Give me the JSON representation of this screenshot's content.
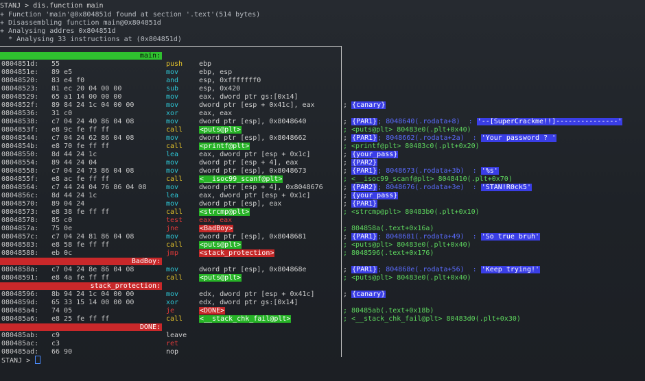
{
  "header": {
    "line0": "STANJ > dis.function main",
    "line1": "+ Function 'main'@0x804851d found at section '.text'(514 bytes)",
    "line2": "+ Disassembling function main@0x804851d",
    "line3": "+ Analysing addres 0x804851d",
    "line4": "  * Analysing 33 instructions at (0x804851d)"
  },
  "labels": {
    "main": "main:",
    "badboy": "BadBoy:",
    "stack_protection": "stack_protection:",
    "done": "DONE:"
  },
  "rows": [
    {
      "addr": "0804851d:",
      "bytes": "55",
      "mn": "push",
      "ops": "ebp",
      "cm": ""
    },
    {
      "addr": "0804851e:",
      "bytes": "89 e5",
      "mn": "mov",
      "ops": "ebp, esp",
      "cm": ""
    },
    {
      "addr": "08048520:",
      "bytes": "83 e4 f0",
      "mn": "and",
      "ops": "esp, 0xfffffff0",
      "cm": ""
    },
    {
      "addr": "08048523:",
      "bytes": "81 ec 20 04 00 00",
      "mn": "sub",
      "ops": "esp, 0x420",
      "cm": ""
    },
    {
      "addr": "08048529:",
      "bytes": "65 a1 14 00 00 00",
      "mn": "mov",
      "ops": "eax, dword ptr gs:[0x14]",
      "cm": ""
    },
    {
      "addr": "0804852f:",
      "bytes": "89 84 24 1c 04 00 00",
      "mn": "mov",
      "ops": "dword ptr [esp + 0x41c], eax",
      "cm_semi": ";",
      "cm_hl": "{canary}"
    },
    {
      "addr": "08048536:",
      "bytes": "31 c0",
      "mn": "xor",
      "ops": "eax, eax",
      "cm": ""
    },
    {
      "addr": "08048538:",
      "bytes": "c7 04 24 40 86 04 08",
      "mn": "mov",
      "ops": "dword ptr [esp], 0x8048640",
      "cm_semi": ";",
      "cm_hl": "{PAR1}",
      "cm_rest": "; 8048640(.rodata+8)  :",
      "cm_str": "'--[SuperCrackme!!]---------------'"
    },
    {
      "addr": "0804853f:",
      "bytes": "e8 9c fe ff ff",
      "mn": "call",
      "ops_hl": "<puts@plt>",
      "cm_plain": "; <puts@plt> 80483e0(.plt+0x40)"
    },
    {
      "addr": "08048544:",
      "bytes": "c7 04 24 62 86 04 08",
      "mn": "mov",
      "ops": "dword ptr [esp], 0x8048662",
      "cm_semi": ";",
      "cm_hl": "{PAR1}",
      "cm_rest": "; 8048662(.rodata+2a)  :",
      "cm_str": "'Your password ? '"
    },
    {
      "addr": "0804854b:",
      "bytes": "e8 70 fe ff ff",
      "mn": "call",
      "ops_hl": "<printf@plt>",
      "cm_plain": "; <printf@plt> 80483c0(.plt+0x20)"
    },
    {
      "addr": "08048550:",
      "bytes": "8d 44 24 1c",
      "mn": "lea",
      "ops": "eax, dword ptr [esp + 0x1c]",
      "cm_semi": ";",
      "cm_hl": "{your_pass}"
    },
    {
      "addr": "08048554:",
      "bytes": "89 44 24 04",
      "mn": "mov",
      "ops": "dword ptr [esp + 4], eax",
      "cm_semi": ";",
      "cm_hl": "{PAR2}"
    },
    {
      "addr": "08048558:",
      "bytes": "c7 04 24 73 86 04 08",
      "mn": "mov",
      "ops": "dword ptr [esp], 0x8048673",
      "cm_semi": ";",
      "cm_hl": "{PAR1}",
      "cm_rest": "; 8048673(.rodata+3b)  :",
      "cm_str": "'%s'"
    },
    {
      "addr": "0804855f:",
      "bytes": "e8 ac fe ff ff",
      "mn": "call",
      "ops_hl": "<__isoc99_scanf@plt>",
      "cm_plain": "; <__isoc99_scanf@plt> 8048410(.plt+0x70)"
    },
    {
      "addr": "08048564:",
      "bytes": "c7 44 24 04 76 86 04 08",
      "mn": "mov",
      "ops": "dword ptr [esp + 4], 0x8048676",
      "cm_semi": ";",
      "cm_hl": "{PAR2}",
      "cm_rest": "; 8048676(.rodata+3e)  :",
      "cm_str": "'STAN!R0ck5'"
    },
    {
      "addr": "0804856c:",
      "bytes": "8d 44 24 1c",
      "mn": "lea",
      "ops": "eax, dword ptr [esp + 0x1c]",
      "cm_semi": ";",
      "cm_hl": "{your_pass}"
    },
    {
      "addr": "08048570:",
      "bytes": "89 04 24",
      "mn": "mov",
      "ops": "dword ptr [esp], eax",
      "cm_semi": ";",
      "cm_hl": "{PAR1}"
    },
    {
      "addr": "08048573:",
      "bytes": "e8 38 fe ff ff",
      "mn": "call",
      "ops_hl": "<strcmp@plt>",
      "cm_plain": "; <strcmp@plt> 80483b0(.plt+0x10)"
    },
    {
      "addr": "08048578:",
      "bytes": "85 c0",
      "mn": "test",
      "ops_red": "eax, eax",
      "cm": ""
    },
    {
      "addr": "0804857a:",
      "bytes": "75 0e",
      "mn": "jne",
      "ops_rhl": "<BadBoy>",
      "cm_plain": "; 804858a(.text+0x16a)"
    },
    {
      "addr": "0804857c:",
      "bytes": "c7 04 24 81 86 04 08",
      "mn": "mov",
      "ops": "dword ptr [esp], 0x8048681",
      "cm_semi": ";",
      "cm_hl": "{PAR1}",
      "cm_rest": "; 8048681(.rodata+49)  :",
      "cm_str": "'So true bruh'"
    },
    {
      "addr": "08048583:",
      "bytes": "e8 58 fe ff ff",
      "mn": "call",
      "ops_hl": "<puts@plt>",
      "cm_plain": "; <puts@plt> 80483e0(.plt+0x40)"
    },
    {
      "addr": "08048588:",
      "bytes": "eb 0c",
      "mn": "jmp",
      "ops_rhl": "<stack_protection>",
      "cm_plain": "; 8048596(.text+0x176)"
    },
    {
      "label": "badboy"
    },
    {
      "addr": "0804858a:",
      "bytes": "c7 04 24 8e 86 04 08",
      "mn": "mov",
      "ops": "dword ptr [esp], 0x804868e",
      "cm_semi": ";",
      "cm_hl": "{PAR1}",
      "cm_rest": "; 804868e(.rodata+56)  :",
      "cm_str": "'Keep trying!'"
    },
    {
      "addr": "08048591:",
      "bytes": "e8 4a fe ff ff",
      "mn": "call",
      "ops_hl": "<puts@plt>",
      "cm_plain": "; <puts@plt> 80483e0(.plt+0x40)"
    },
    {
      "label": "stack_protection"
    },
    {
      "addr": "08048596:",
      "bytes": "8b 94 24 1c 04 00 00",
      "mn": "mov",
      "ops": "edx, dword ptr [esp + 0x41c]",
      "cm_semi": ";",
      "cm_hl": "{canary}"
    },
    {
      "addr": "0804859d:",
      "bytes": "65 33 15 14 00 00 00",
      "mn": "xor",
      "ops": "edx, dword ptr gs:[0x14]",
      "cm": ""
    },
    {
      "addr": "080485a4:",
      "bytes": "74 05",
      "mn": "je",
      "ops_rhl": "<DONE>",
      "cm_plain": "; 80485ab(.text+0x18b)"
    },
    {
      "addr": "080485a6:",
      "bytes": "e8 25 fe ff ff",
      "mn": "call",
      "ops_hl": "<__stack_chk_fail@plt>",
      "cm_plain": "; <__stack_chk_fail@plt> 80483d0(.plt+0x30)"
    },
    {
      "label": "done"
    },
    {
      "addr": "080485ab:",
      "bytes": "c9",
      "mn": "leave",
      "ops": "",
      "cm": ""
    },
    {
      "addr": "080485ac:",
      "bytes": "c3",
      "mn": "ret",
      "ops": "",
      "cm": ""
    },
    {
      "addr": "080485ad:",
      "bytes": "66 90",
      "mn": "nop",
      "ops": "",
      "cm": ""
    }
  ],
  "prompt": "STANJ > ",
  "colors": {
    "label_green": "#2fc02f",
    "label_red": "#c9282a",
    "highlight_blue": "#3a3ee6",
    "mnemonic_cyan": "#2ec7d6",
    "mnemonic_yellow": "#e3c22b"
  }
}
